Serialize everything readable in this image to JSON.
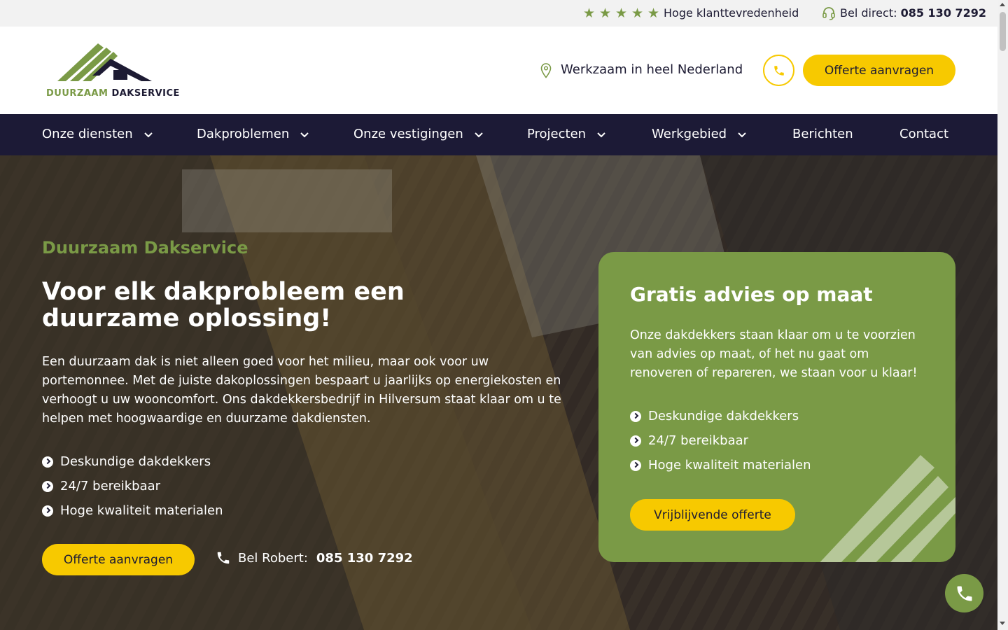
{
  "topbar": {
    "stars": 5,
    "rating_text": "Hoge klanttevredenheid",
    "phone_prefix": "Bel direct:",
    "phone_number": "085 130 7292"
  },
  "header": {
    "logo_text_green": "DUURZAAM ",
    "logo_text_dark": "DAKSERVICE",
    "location": "Werkzaam in heel Nederland",
    "cta": "Offerte aanvragen"
  },
  "nav": {
    "items": [
      {
        "label": "Onze diensten",
        "dropdown": true
      },
      {
        "label": "Dakproblemen",
        "dropdown": true
      },
      {
        "label": "Onze vestigingen",
        "dropdown": true
      },
      {
        "label": "Projecten",
        "dropdown": true
      },
      {
        "label": "Werkgebied",
        "dropdown": true
      },
      {
        "label": "Berichten",
        "dropdown": false
      },
      {
        "label": "Contact",
        "dropdown": false
      }
    ]
  },
  "hero": {
    "kicker": "Duurzaam Dakservice",
    "title": "Voor elk dakprobleem een duurzame oplossing!",
    "lead": "Een duurzaam dak is niet alleen goed voor het milieu, maar ook voor uw portemonnee. Met de juiste dakoplossingen bespaart u jaarlijks op energiekosten en verhoogt u uw wooncomfort. Ons dakdekkersbedrijf in Hilversum staat klaar om u te helpen met hoogwaardige en duurzame dakdiensten.",
    "bullets": [
      "Deskundige dakdekkers",
      "24/7 bereikbaar",
      "Hoge kwaliteit materialen"
    ],
    "cta": "Offerte aanvragen",
    "bel_label": "Bel Robert:",
    "bel_number": "085 130 7292"
  },
  "card": {
    "title": "Gratis advies op maat",
    "text": "Onze dakdekkers staan klaar om u te voorzien van advies op maat, of het nu gaat om renoveren of repareren, we staan voor u klaar!",
    "bullets": [
      "Deskundige dakdekkers",
      "24/7 bereikbaar",
      "Hoge kwaliteit materialen"
    ],
    "cta": "Vrijblijvende offerte"
  },
  "colors": {
    "brand_green": "#7a9a46",
    "brand_yellow": "#f7c900",
    "navy": "#1c1a36"
  },
  "icons": [
    "star-icon",
    "headset-icon",
    "location-pin-icon",
    "phone-icon",
    "chevron-down-icon",
    "check-circle-icon"
  ]
}
